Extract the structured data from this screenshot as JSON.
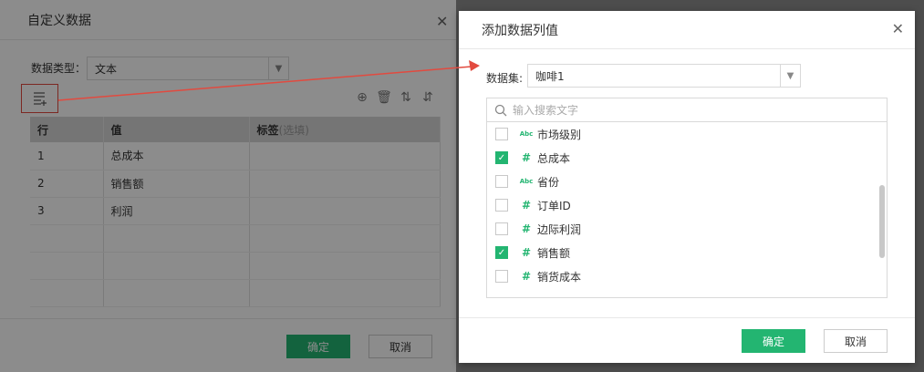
{
  "bg_dialog": {
    "title": "自定义数据",
    "type_label": "数据类型：",
    "type_value": "文本",
    "table": {
      "headers": [
        "行",
        "值",
        "标签"
      ],
      "label_hint": "(选填)",
      "rows": [
        [
          "1",
          "总成本",
          ""
        ],
        [
          "2",
          "销售额",
          ""
        ],
        [
          "3",
          "利润",
          ""
        ]
      ]
    },
    "ok_label": "确定",
    "cancel_label": "取消"
  },
  "fg_dialog": {
    "title": "添加数据列值",
    "dataset_label": "数据集:",
    "dataset_value": "咖啡1",
    "search_placeholder": "输入搜索文字",
    "fields": [
      {
        "name": "市场级别",
        "type": "Abc",
        "checked": false
      },
      {
        "name": "总成本",
        "type": "#",
        "checked": true
      },
      {
        "name": "省份",
        "type": "Abc",
        "checked": false
      },
      {
        "name": "订单ID",
        "type": "#",
        "checked": false
      },
      {
        "name": "边际利润",
        "type": "#",
        "checked": false
      },
      {
        "name": "销售额",
        "type": "#",
        "checked": true
      },
      {
        "name": "销货成本",
        "type": "#",
        "checked": false
      }
    ],
    "ok_label": "确定",
    "cancel_label": "取消"
  },
  "colors": {
    "accent": "#23b571",
    "highlight": "#e24a3f"
  }
}
